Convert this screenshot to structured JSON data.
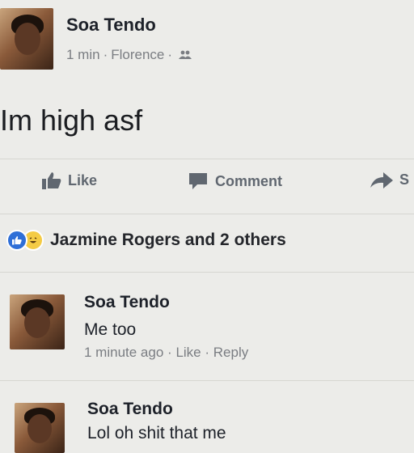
{
  "post": {
    "author": "Soa Tendo",
    "time": "1 min",
    "separator": "·",
    "location": "Florence",
    "privacy_icon": "friends-icon",
    "text": "Im high asf"
  },
  "actions": {
    "like_label": "Like",
    "comment_label": "Comment",
    "share_label": "S"
  },
  "reactions": {
    "icons": [
      "like-reaction-icon",
      "haha-reaction-icon"
    ],
    "summary": "Jazmine Rogers and 2 others"
  },
  "comments": [
    {
      "author": "Soa Tendo",
      "text": "Me too",
      "time": "1 minute ago",
      "like_label": "Like",
      "reply_label": "Reply"
    },
    {
      "author": "Soa Tendo",
      "text": "Lol oh shit that me"
    }
  ],
  "colors": {
    "background": "#ecece9",
    "meta_text": "#7a7d82",
    "action_text": "#606770",
    "like_blue": "#2f6fd7",
    "haha_yellow": "#f4cb45"
  }
}
